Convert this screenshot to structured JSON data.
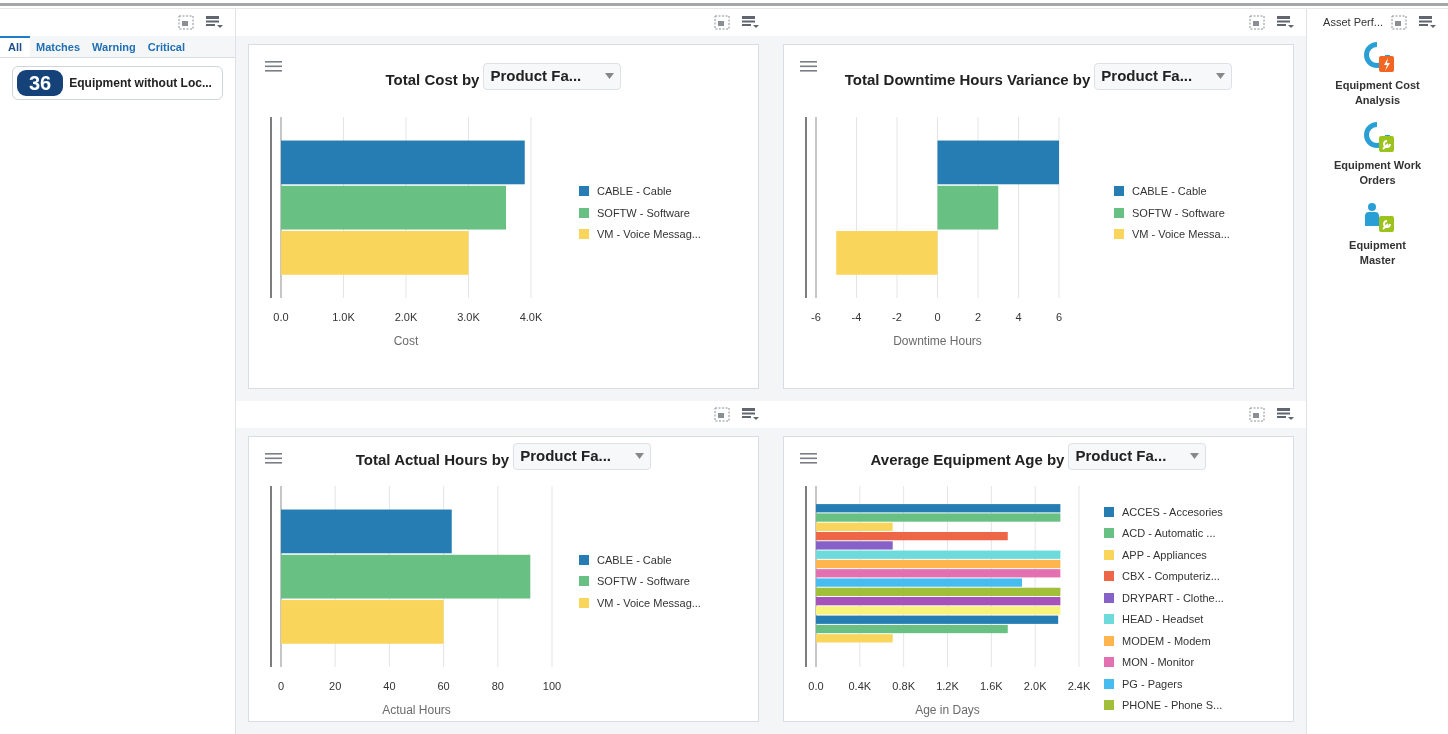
{
  "sidebar": {
    "tabs": [
      {
        "label": "All",
        "selected": true
      },
      {
        "label": "Matches",
        "selected": false
      },
      {
        "label": "Warning",
        "selected": false
      },
      {
        "label": "Critical",
        "selected": false
      }
    ],
    "items": [
      {
        "count": "36",
        "label": "Equipment without Loc..."
      }
    ]
  },
  "charts": [
    {
      "title": "Total Cost by",
      "dropdown": "Product Fa...",
      "chart_data": {
        "type": "bar",
        "orientation": "horizontal",
        "grid": true,
        "xlabel": "Cost",
        "xlim": [
          0,
          4000
        ],
        "xticks": [
          {
            "value": 0,
            "label": "0.0"
          },
          {
            "value": 1000,
            "label": "1.0K"
          },
          {
            "value": 2000,
            "label": "2.0K"
          },
          {
            "value": 3000,
            "label": "3.0K"
          },
          {
            "value": 4000,
            "label": "4.0K"
          }
        ],
        "series": [
          {
            "name": "CABLE - Cable",
            "color": "#267db3",
            "values": [
              3900
            ]
          },
          {
            "name": "SOFTW - Software",
            "color": "#68c182",
            "values": [
              3600
            ]
          },
          {
            "name": "VM - Voice Messag...",
            "color": "#fad55c",
            "values": [
              3000
            ]
          }
        ]
      }
    },
    {
      "title": "Total Downtime Hours Variance by",
      "dropdown": "Product Fa...",
      "chart_data": {
        "type": "bar",
        "orientation": "horizontal",
        "grid": true,
        "xlabel": "Downtime Hours",
        "xlim": [
          -6,
          6
        ],
        "xticks": [
          -6,
          -4,
          -2,
          0,
          2,
          4,
          6
        ],
        "series": [
          {
            "name": "CABLE - Cable",
            "color": "#267db3",
            "values": [
              6
            ]
          },
          {
            "name": "SOFTW - Software",
            "color": "#68c182",
            "values": [
              3
            ]
          },
          {
            "name": "VM - Voice Messa...",
            "color": "#fad55c",
            "values": [
              -5
            ]
          }
        ]
      }
    },
    {
      "title": "Total Actual Hours by",
      "dropdown": "Product Fa...",
      "chart_data": {
        "type": "bar",
        "orientation": "horizontal",
        "grid": true,
        "xlabel": "Actual Hours",
        "xlim": [
          0,
          100
        ],
        "xticks": [
          0,
          20,
          40,
          60,
          80,
          100
        ],
        "series": [
          {
            "name": "CABLE - Cable",
            "color": "#267db3",
            "values": [
              63
            ]
          },
          {
            "name": "SOFTW - Software",
            "color": "#68c182",
            "values": [
              92
            ]
          },
          {
            "name": "VM - Voice Messag...",
            "color": "#fad55c",
            "values": [
              60
            ]
          }
        ]
      }
    },
    {
      "title": "Average Equipment Age by",
      "dropdown": "Product Fa...",
      "chart_data": {
        "type": "bar",
        "orientation": "horizontal",
        "grid": true,
        "xlabel": "Age in Days",
        "xlim": [
          0,
          2400
        ],
        "xticks": [
          {
            "value": 0,
            "label": "0.0"
          },
          {
            "value": 400,
            "label": "0.4K"
          },
          {
            "value": 800,
            "label": "0.8K"
          },
          {
            "value": 1200,
            "label": "1.2K"
          },
          {
            "value": 1600,
            "label": "1.6K"
          },
          {
            "value": 2000,
            "label": "2.0K"
          },
          {
            "value": 2400,
            "label": "2.4K"
          }
        ],
        "series": [
          {
            "name": "ACCES - Accesories",
            "color": "#267db3",
            "values": [
              2230
            ]
          },
          {
            "name": "ACD - Automatic ...",
            "color": "#68c182",
            "values": [
              2230
            ]
          },
          {
            "name": "APP - Appliances",
            "color": "#fad55c",
            "values": [
              700
            ]
          },
          {
            "name": "CBX - Computeriz...",
            "color": "#ed6647",
            "values": [
              1750
            ]
          },
          {
            "name": "DRYPART - Clothe...",
            "color": "#8561c8",
            "values": [
              700
            ]
          },
          {
            "name": "HEAD - Headset",
            "color": "#6ddbdb",
            "values": [
              2230
            ]
          },
          {
            "name": "MODEM - Modem",
            "color": "#ffb54d",
            "values": [
              2230
            ]
          },
          {
            "name": "MON - Monitor",
            "color": "#e371b2",
            "values": [
              2230
            ]
          },
          {
            "name": "PG - Pagers",
            "color": "#47bdef",
            "values": [
              1880
            ]
          },
          {
            "name": "PHONE - Phone S...",
            "color": "#a2bf39",
            "values": [
              2230
            ]
          },
          {
            "color": "#a752b8",
            "values": [
              2230
            ]
          },
          {
            "color": "#f7f37b",
            "values": [
              2230
            ]
          },
          {
            "color": "#267db3",
            "values": [
              2210
            ]
          },
          {
            "color": "#68c182",
            "values": [
              1750
            ]
          },
          {
            "color": "#fad55c",
            "values": [
              700
            ]
          }
        ]
      }
    }
  ],
  "launcher": {
    "title": "Asset Perf...",
    "items": [
      {
        "kind": "cost",
        "label": "Equipment Cost Analysis"
      },
      {
        "kind": "orders",
        "label": "Equipment Work Orders"
      },
      {
        "kind": "master",
        "label": "Equipment Master"
      }
    ]
  }
}
